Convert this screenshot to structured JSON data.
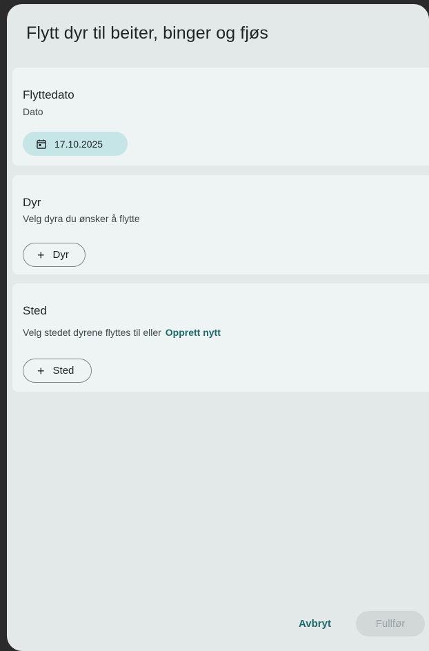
{
  "dialog": {
    "title": "Flytt dyr til beiter, binger og fjøs"
  },
  "date_section": {
    "title": "Flyttedato",
    "subtitle": "Dato",
    "date_value": "17.10.2025",
    "icon": "calendar-icon"
  },
  "animals_section": {
    "title": "Dyr",
    "subtitle": "Velg dyra du ønsker å flytte",
    "add_label": "Dyr",
    "add_icon": "plus-icon"
  },
  "place_section": {
    "title": "Sted",
    "subtitle": "Velg stedet dyrene flyttes til eller",
    "create_link": "Opprett nytt",
    "add_label": "Sted",
    "add_icon": "plus-icon"
  },
  "actions": {
    "cancel_label": "Avbryt",
    "finish_label": "Fullfør"
  },
  "colors": {
    "accent": "#1d6a6c",
    "date_chip_bg": "#c6e5e6",
    "dialog_bg": "#e3e8e8",
    "card_bg": "#eef3f3"
  }
}
